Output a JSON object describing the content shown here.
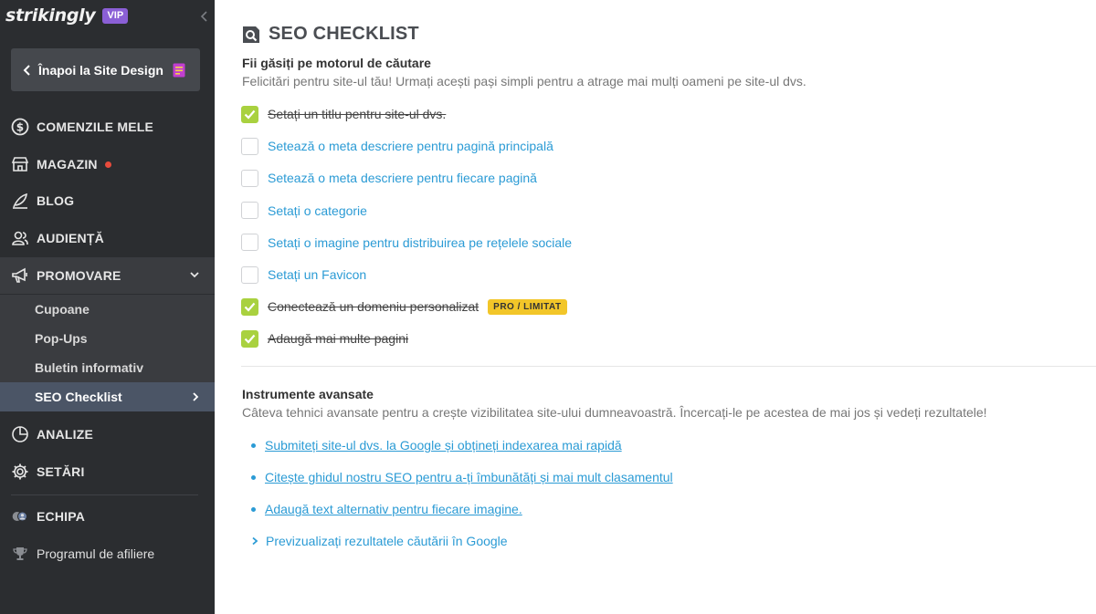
{
  "sidebar": {
    "logo": "strikingly",
    "vip_badge": "VIP",
    "back_label": "Înapoi la Site Design",
    "items": [
      {
        "label": "COMENZILE MELE",
        "icon": "dollar-circle-icon"
      },
      {
        "label": "MAGAZIN",
        "icon": "store-icon",
        "has_dot": true
      },
      {
        "label": "BLOG",
        "icon": "quill-icon"
      },
      {
        "label": "AUDIENȚĂ",
        "icon": "users-icon"
      },
      {
        "label": "PROMOVARE",
        "icon": "megaphone-icon",
        "expanded": true
      }
    ],
    "sub_items": [
      {
        "label": "Cupoane"
      },
      {
        "label": "Pop-Ups"
      },
      {
        "label": "Buletin informativ"
      },
      {
        "label": "SEO Checklist",
        "active": true
      }
    ],
    "items_after": [
      {
        "label": "ANALIZE",
        "icon": "pie-chart-icon"
      },
      {
        "label": "SETĂRI",
        "icon": "gear-icon"
      }
    ],
    "team_label": "ECHIPA",
    "affiliate_label": "Programul de afiliere"
  },
  "main": {
    "title": "SEO CHECKLIST",
    "search_section": {
      "heading": "Fii găsiți pe motorul de căutare",
      "description": "Felicitări pentru site-ul tău! Urmați acești pași simpli pentru a atrage mai mulți oameni pe site-ul dvs.",
      "tasks": [
        {
          "label": "Setați un titlu pentru site-ul dvs.",
          "done": true
        },
        {
          "label": "Setează o meta descriere pentru pagină principală",
          "done": false
        },
        {
          "label": "Setează o meta descriere pentru fiecare pagină",
          "done": false
        },
        {
          "label": "Setați o categorie",
          "done": false
        },
        {
          "label": "Setați o imagine pentru distribuirea pe rețelele sociale",
          "done": false
        },
        {
          "label": "Setați un Favicon",
          "done": false
        },
        {
          "label": "Conectează un domeniu personalizat",
          "done": true,
          "badge": "PRO / LIMITAT"
        },
        {
          "label": "Adaugă mai multe pagini",
          "done": true
        }
      ]
    },
    "advanced_section": {
      "heading": "Instrumente avansate",
      "description": "Câteva tehnici avansate pentru a crește vizibilitatea site-ului dumneavoastră. Încercați-le pe acestea de mai jos și vedeți rezultatele!",
      "links": [
        {
          "label": "Submiteți site-ul dvs. la Google și obțineți indexarea mai rapidă"
        },
        {
          "label": "Citește ghidul nostru SEO pentru a-ți îmbunătăți și mai mult clasamentul"
        },
        {
          "label": "Adaugă text alternativ pentru fiecare imagine."
        }
      ],
      "preview_label": "Previzualizați rezultatele căutării în Google"
    }
  },
  "colors": {
    "sidebar_bg": "#2b2d30",
    "active_bg": "#4b5566",
    "accent_blue": "#2b9bd5",
    "check_green": "#a9d13f",
    "badge_yellow": "#f2c629",
    "vip_purple": "#8b5fd6"
  }
}
